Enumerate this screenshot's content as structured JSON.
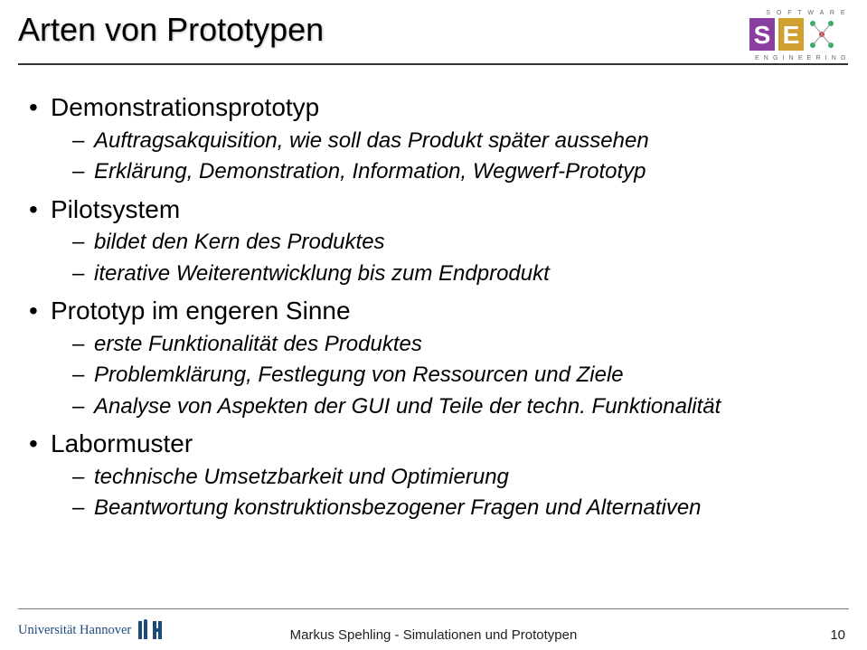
{
  "title": "Arten von Prototypen",
  "logo": {
    "top_label": "S O F T W A R E",
    "bottom_label": "E N G I N E E R I N G",
    "big_s": "S",
    "big_e": "E"
  },
  "bullets": [
    {
      "label": "Demonstrationsprototyp",
      "subs": [
        "Auftragsakquisition, wie soll das Produkt später aussehen",
        "Erklärung, Demonstration, Information, Wegwerf-Prototyp"
      ]
    },
    {
      "label": "Pilotsystem",
      "subs": [
        "bildet den Kern des Produktes",
        "iterative Weiterentwicklung bis zum Endprodukt"
      ]
    },
    {
      "label": "Prototyp im engeren Sinne",
      "subs": [
        "erste Funktionalität des Produktes",
        "Problemklärung, Festlegung von Ressourcen und Ziele",
        "Analyse von Aspekten der GUI und Teile der techn. Funktionalität"
      ]
    },
    {
      "label": "Labormuster",
      "subs": [
        "technische Umsetzbarkeit und Optimierung",
        "Beantwortung konstruktionsbezogener Fragen und Alternativen"
      ]
    }
  ],
  "footer": {
    "uni": "Universität Hannover",
    "center": "Markus Spehling  -  Simulationen und Prototypen",
    "page": "10"
  }
}
